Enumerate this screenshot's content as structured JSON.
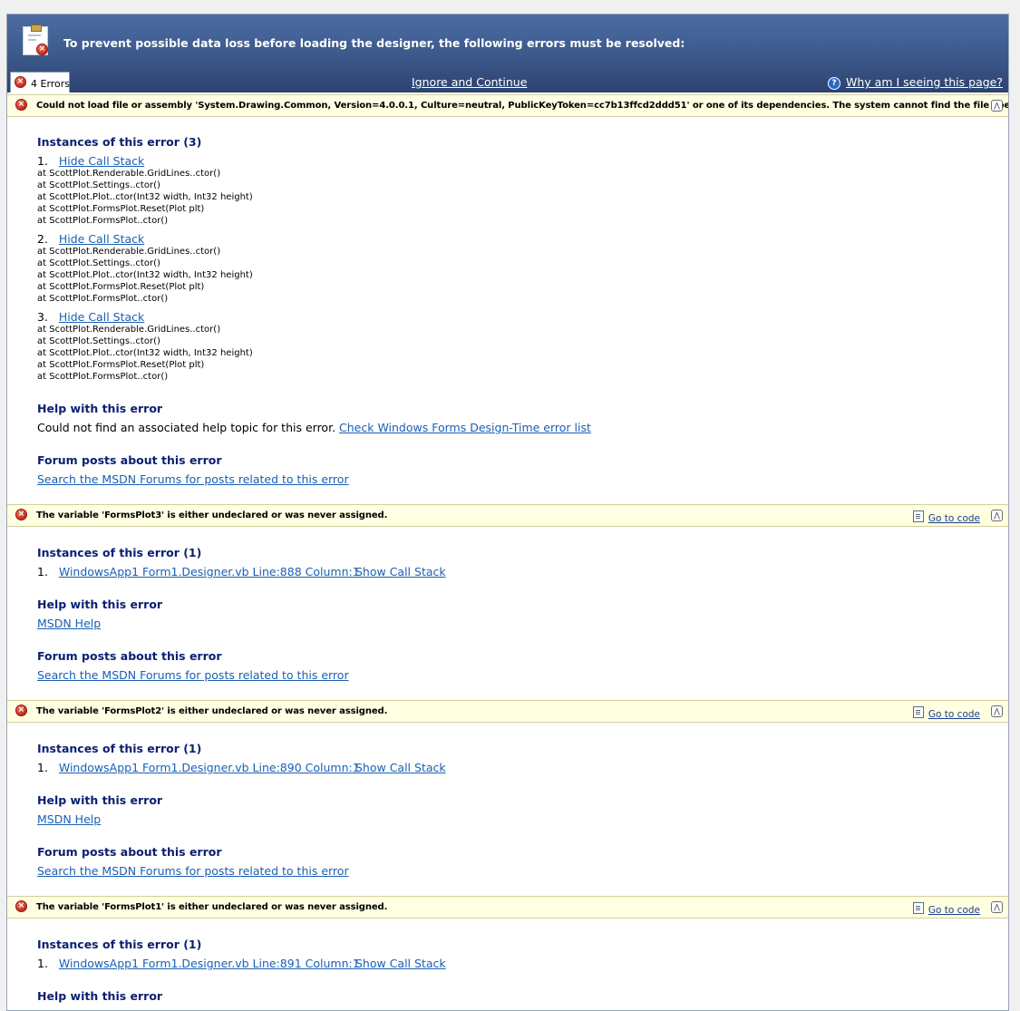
{
  "header": {
    "title": "To prevent possible data loss before loading the designer, the following errors must be resolved:",
    "errors_tab": "4 Errors",
    "ignore_link": "Ignore and Continue",
    "why_link": "Why am I seeing this page?"
  },
  "common": {
    "instances_heading_3": "Instances of this error (3)",
    "instances_heading_1": "Instances of this error (1)",
    "help_heading": "Help with this error",
    "forum_heading": "Forum posts about this error",
    "forum_link": "Search the MSDN Forums for posts related to this error",
    "hide_call_stack": "Hide Call Stack",
    "show_call_stack": "Show Call Stack",
    "go_to_code": "Go to code",
    "msdn_help": "MSDN Help"
  },
  "errors": [
    {
      "message": "Could not load file or assembly 'System.Drawing.Common, Version=4.0.0.1, Culture=neutral, PublicKeyToken=cc7b13ffcd2ddd51' or one of its dependencies. The system cannot find the file specified.",
      "help_text": "Could not find an associated help topic for this error.",
      "help_link": "Check Windows Forms Design-Time error list",
      "instances": [
        {
          "number": "1.",
          "stack": "at ScottPlot.Renderable.GridLines..ctor()\nat ScottPlot.Settings..ctor()\nat ScottPlot.Plot..ctor(Int32 width, Int32 height)\nat ScottPlot.FormsPlot.Reset(Plot plt)\nat ScottPlot.FormsPlot..ctor()"
        },
        {
          "number": "2.",
          "stack": "at ScottPlot.Renderable.GridLines..ctor()\nat ScottPlot.Settings..ctor()\nat ScottPlot.Plot..ctor(Int32 width, Int32 height)\nat ScottPlot.FormsPlot.Reset(Plot plt)\nat ScottPlot.FormsPlot..ctor()"
        },
        {
          "number": "3.",
          "stack": "at ScottPlot.Renderable.GridLines..ctor()\nat ScottPlot.Settings..ctor()\nat ScottPlot.Plot..ctor(Int32 width, Int32 height)\nat ScottPlot.FormsPlot.Reset(Plot plt)\nat ScottPlot.FormsPlot..ctor()"
        }
      ]
    },
    {
      "message": "The variable 'FormsPlot3' is either undeclared or was never assigned.",
      "instance_number": "1.",
      "instance_link": "WindowsApp1 Form1.Designer.vb Line:888 Column:1"
    },
    {
      "message": "The variable 'FormsPlot2' is either undeclared or was never assigned.",
      "instance_number": "1.",
      "instance_link": "WindowsApp1 Form1.Designer.vb Line:890 Column:1"
    },
    {
      "message": "The variable 'FormsPlot1' is either undeclared or was never assigned.",
      "instance_number": "1.",
      "instance_link": "WindowsApp1 Form1.Designer.vb Line:891 Column:1"
    }
  ]
}
